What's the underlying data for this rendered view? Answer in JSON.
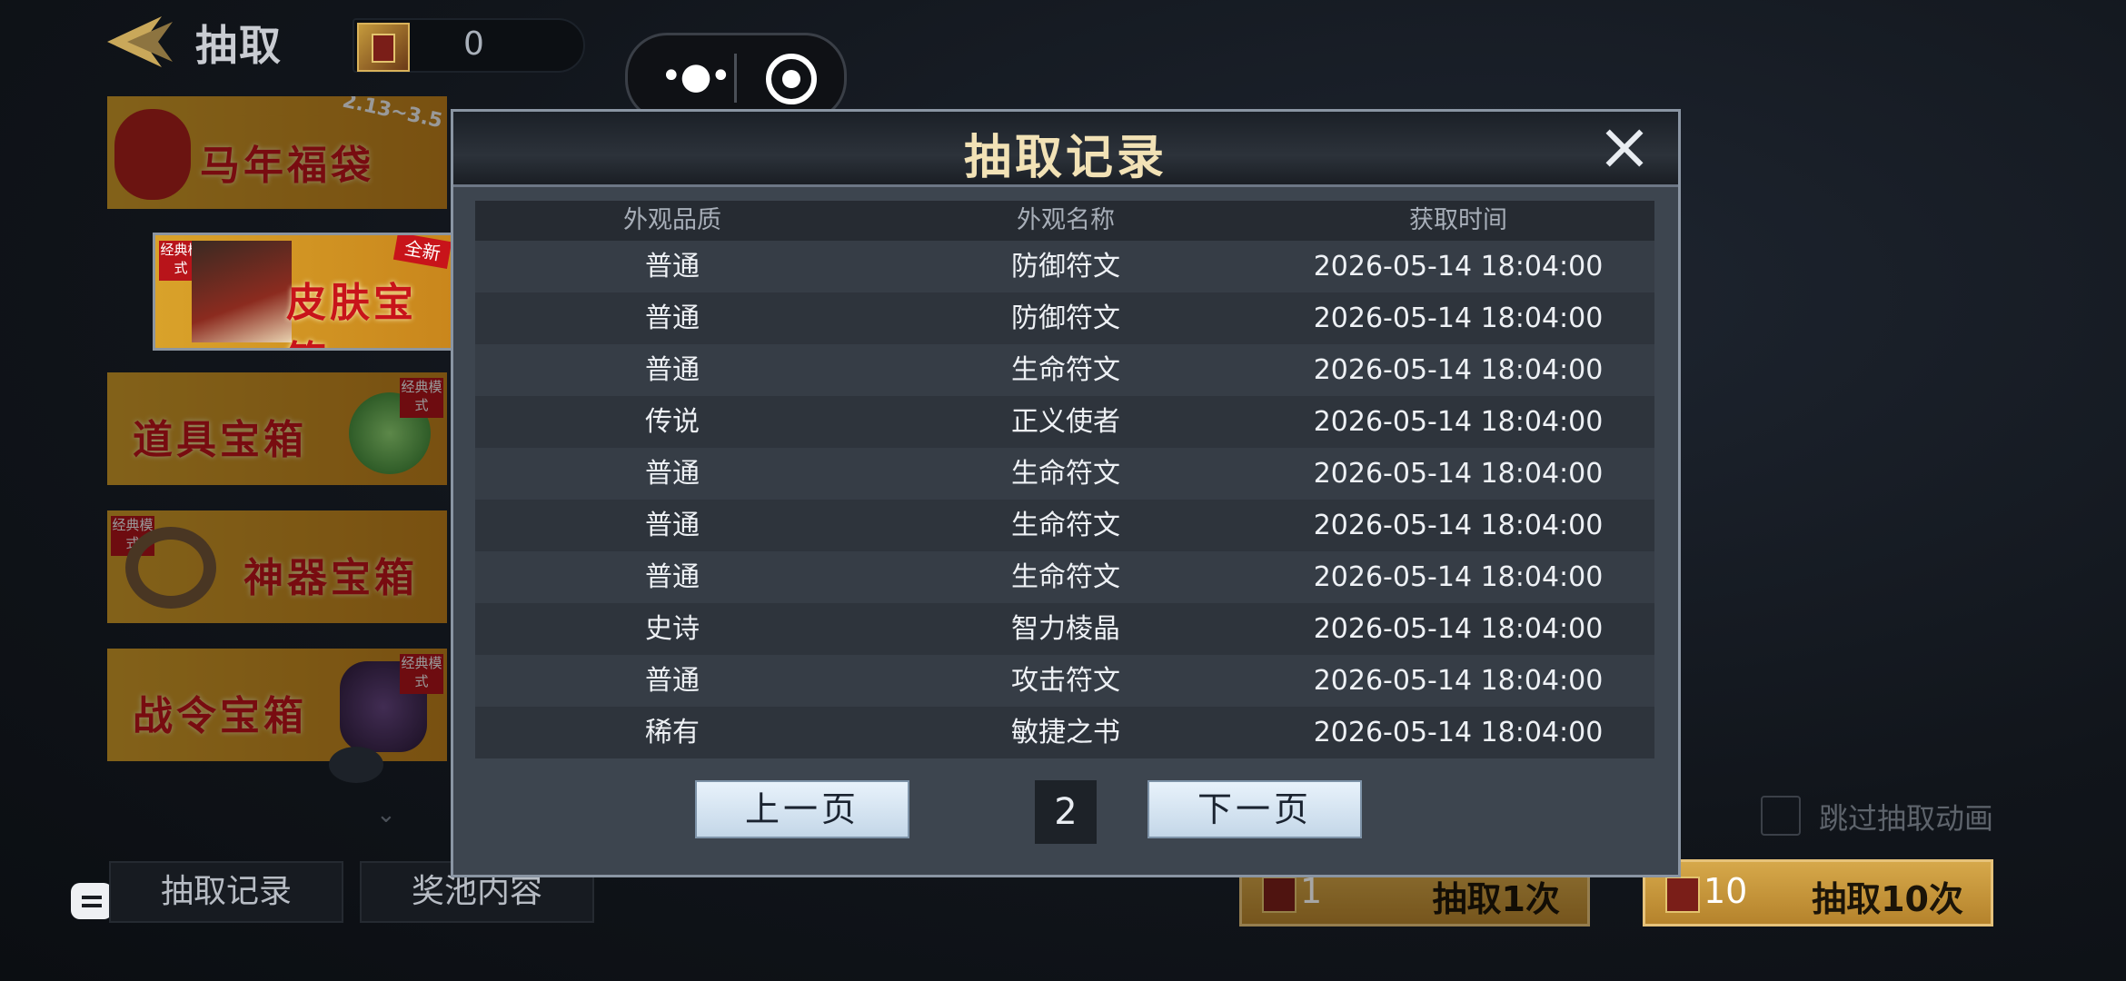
{
  "header": {
    "title": "抽取",
    "currency_amount": "0"
  },
  "capsule": {
    "more_icon": "more-dots-icon",
    "close_icon": "target-icon"
  },
  "banners": [
    {
      "label": "马年福袋",
      "badge": "2.13~3.5"
    },
    {
      "label": "皮肤宝箱",
      "badge": "全新",
      "tag": "经典模式"
    },
    {
      "label": "道具宝箱",
      "tag": "经典模式"
    },
    {
      "label": "神器宝箱",
      "tag": "经典模式"
    },
    {
      "label": "战令宝箱",
      "tag": "经典模式"
    }
  ],
  "bottom_tabs": {
    "records": "抽取记录",
    "pool": "奖池内容"
  },
  "skip_animation_label": "跳过抽取动画",
  "draw_buttons": [
    {
      "count": "1",
      "label": "抽取1次"
    },
    {
      "count": "10",
      "label": "抽取10次"
    }
  ],
  "modal": {
    "title": "抽取记录",
    "columns": [
      "外观品质",
      "外观名称",
      "获取时间"
    ],
    "rows": [
      [
        "普通",
        "防御符文",
        "2026-05-14 18:04:00"
      ],
      [
        "普通",
        "防御符文",
        "2026-05-14 18:04:00"
      ],
      [
        "普通",
        "生命符文",
        "2026-05-14 18:04:00"
      ],
      [
        "传说",
        "正义使者",
        "2026-05-14 18:04:00"
      ],
      [
        "普通",
        "生命符文",
        "2026-05-14 18:04:00"
      ],
      [
        "普通",
        "生命符文",
        "2026-05-14 18:04:00"
      ],
      [
        "普通",
        "生命符文",
        "2026-05-14 18:04:00"
      ],
      [
        "史诗",
        "智力棱晶",
        "2026-05-14 18:04:00"
      ],
      [
        "普通",
        "攻击符文",
        "2026-05-14 18:04:00"
      ],
      [
        "稀有",
        "敏捷之书",
        "2026-05-14 18:04:00"
      ]
    ],
    "prev_label": "上一页",
    "next_label": "下一页",
    "page": "2"
  }
}
